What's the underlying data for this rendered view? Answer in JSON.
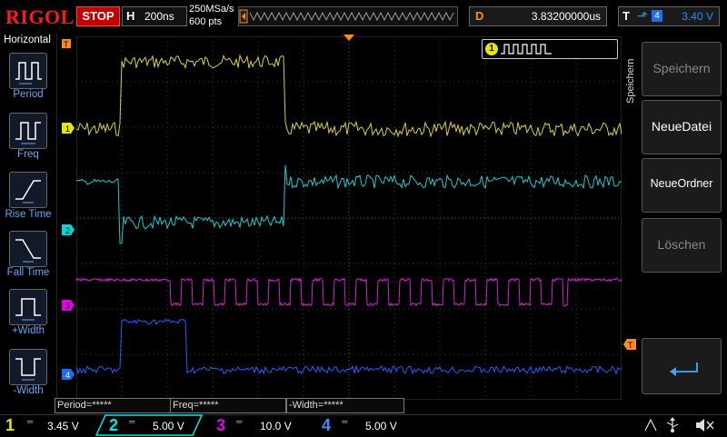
{
  "topbar": {
    "logo": "RIGOL",
    "status": "STOP",
    "timebase_label": "H",
    "timebase_value": "200ns",
    "sample_rate": "250MSa/s",
    "memory_depth": "600 pts",
    "delay_label": "D",
    "delay_value": "3.83200000us",
    "trigger_label": "T",
    "trigger_channel": "4",
    "trigger_level": "3.40 V"
  },
  "left_panel": {
    "title": "Horizontal",
    "items": [
      {
        "label": "Period",
        "icon": "period-icon"
      },
      {
        "label": "Freq",
        "icon": "freq-icon"
      },
      {
        "label": "Rise Time",
        "icon": "rise-time-icon"
      },
      {
        "label": "Fall Time",
        "icon": "fall-time-icon"
      },
      {
        "label": "+Width",
        "icon": "positive-width-icon"
      },
      {
        "label": "-Width",
        "icon": "negative-width-icon"
      }
    ]
  },
  "right_menu": {
    "tab": "Speichern",
    "items": [
      {
        "label": "Speichern",
        "enabled": false
      },
      {
        "label": "NeueDatei",
        "enabled": true
      },
      {
        "label": "NeueOrdner",
        "enabled": true
      },
      {
        "label": "Löschen",
        "enabled": false
      },
      {
        "label": "",
        "icon": "enter-icon",
        "enabled": true
      }
    ]
  },
  "measurements": [
    {
      "label": "Period=*****"
    },
    {
      "label": "Freq=*****"
    },
    {
      "label": "-Width=*****"
    }
  ],
  "channels": [
    {
      "num": "1",
      "scale": "3.45 V",
      "color": "#e6e600"
    },
    {
      "num": "2",
      "scale": "5.00 V",
      "color": "#00e6e6"
    },
    {
      "num": "3",
      "scale": "10.0 V",
      "color": "#e600e6"
    },
    {
      "num": "4",
      "scale": "5.00 V",
      "color": "#1e6cff"
    }
  ],
  "markers": {
    "trigger_pos": "T",
    "trigger_level": "T",
    "ch1": "1",
    "ch2": "2",
    "ch3": "3",
    "ch4": "4"
  },
  "colors": {
    "ch1": "#d8d040",
    "ch2": "#20c8d0",
    "ch3": "#d020d0",
    "ch4": "#2060ff",
    "accent": "#ff8c1a"
  }
}
